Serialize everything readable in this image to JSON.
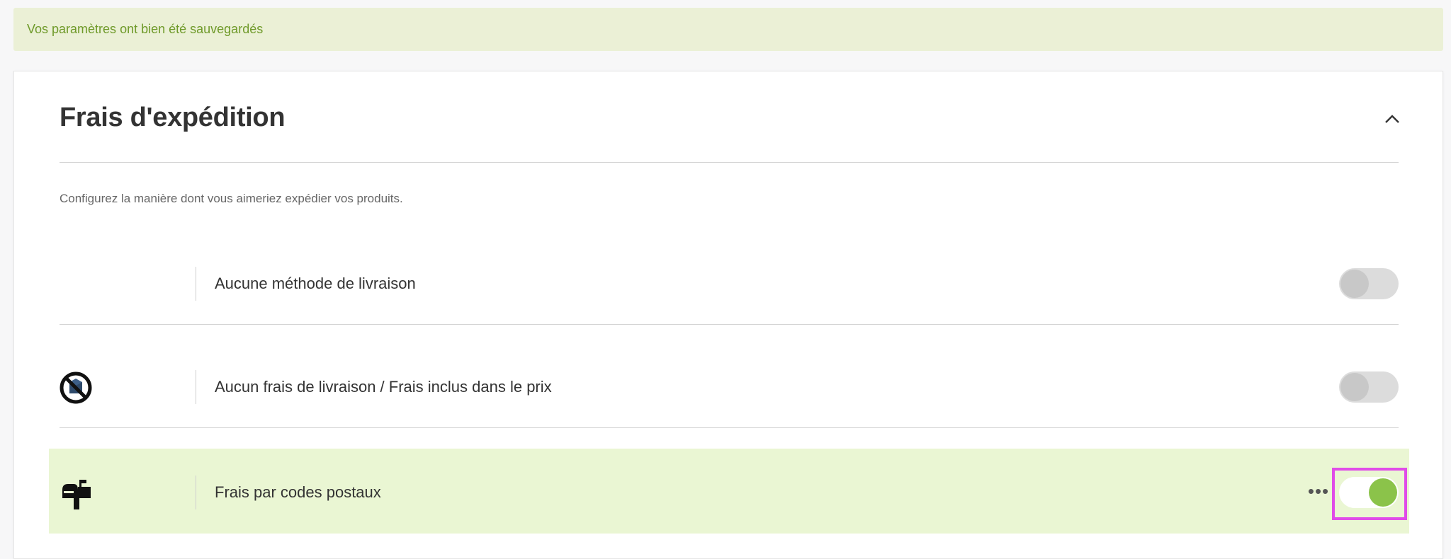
{
  "alert": {
    "message": "Vos paramètres ont bien été sauvegardés"
  },
  "section": {
    "title": "Frais d'expédition",
    "description": "Configurez la manière dont vous aimeriez expédier vos produits.",
    "collapse_icon": "chevron-up-icon"
  },
  "methods": [
    {
      "label": "Aucune méthode de livraison",
      "icon": "",
      "enabled": false
    },
    {
      "label": "Aucun frais de livraison / Frais inclus dans le prix",
      "icon": "no-shipping-icon",
      "enabled": false
    },
    {
      "label": "Frais par codes postaux",
      "icon": "mailbox-icon",
      "enabled": true,
      "more_icon": "more-options-icon",
      "more_label": "•••"
    }
  ],
  "colors": {
    "alert_bg": "#ebf0d6",
    "alert_text": "#6f9a2a",
    "active_row_bg": "#eaf6d3",
    "toggle_on": "#8bc34a",
    "highlight": "#e04ce8"
  }
}
